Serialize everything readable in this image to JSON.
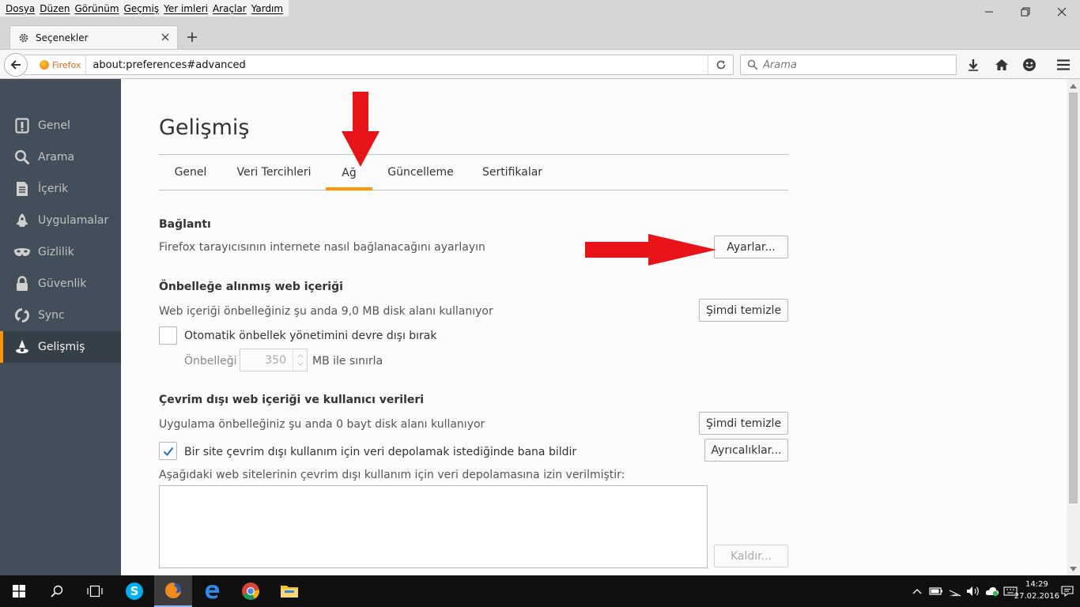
{
  "menubar": {
    "items": [
      "Dosya",
      "Düzen",
      "Görünüm",
      "Geçmiş",
      "Yer imleri",
      "Araçlar",
      "Yardım"
    ]
  },
  "tab": {
    "title": "Seçenekler"
  },
  "urlbar": {
    "identity_label": "Firefox",
    "url": "about:preferences#advanced"
  },
  "searchbar": {
    "placeholder": "Arama"
  },
  "sidebar": {
    "items": [
      {
        "label": "Genel",
        "icon": "general-icon"
      },
      {
        "label": "Arama",
        "icon": "search-icon"
      },
      {
        "label": "İçerik",
        "icon": "content-icon"
      },
      {
        "label": "Uygulamalar",
        "icon": "applications-icon"
      },
      {
        "label": "Gizlilik",
        "icon": "privacy-mask-icon"
      },
      {
        "label": "Güvenlik",
        "icon": "lock-icon"
      },
      {
        "label": "Sync",
        "icon": "sync-icon"
      },
      {
        "label": "Gelişmiş",
        "icon": "advanced-wizard-icon"
      }
    ],
    "selected": "Gelişmiş"
  },
  "main": {
    "title": "Gelişmiş",
    "tabs": [
      "Genel",
      "Veri Tercihleri",
      "Ağ",
      "Güncelleme",
      "Sertifikalar"
    ],
    "active_tab": "Ağ",
    "connection": {
      "title": "Bağlantı",
      "desc": "Firefox tarayıcısının internete nasıl bağlanacağını ayarlayın",
      "settings_button": "Ayarlar..."
    },
    "cache": {
      "title": "Önbelleğe alınmış web içeriği",
      "desc": "Web içeriği önbelleğiniz şu anda 9,0 MB disk alanı kullanıyor",
      "clear_button": "Şimdi temizle",
      "override_checkbox_label": "Otomatik önbellek yönetimini devre dışı bırak",
      "override_checked": false,
      "limit_label": "Önbelleği",
      "limit_value": "350",
      "limit_unit": "MB ile sınırla"
    },
    "offline": {
      "title": "Çevrim dışı web içeriği ve kullanıcı verileri",
      "desc": "Uygulama önbelleğiniz şu anda 0 bayt disk alanı kullanıyor",
      "clear_button": "Şimdi temizle",
      "notify_checkbox_label": "Bir site çevrim dışı kullanım için veri depolamak istediğinde bana bildir",
      "notify_checked": true,
      "exceptions_button": "Ayrıcalıklar...",
      "list_label": "Aşağıdaki web sitelerinin çevrim dışı kullanım için veri depolamasına izin verilmiştir:",
      "remove_button": "Kaldır..."
    }
  },
  "taskbar": {
    "time": "14:29",
    "date": "27.02.2016"
  },
  "colors": {
    "accent": "#ff9500",
    "sidebar_bg": "#424f5a",
    "arrow": "#e8141a"
  }
}
